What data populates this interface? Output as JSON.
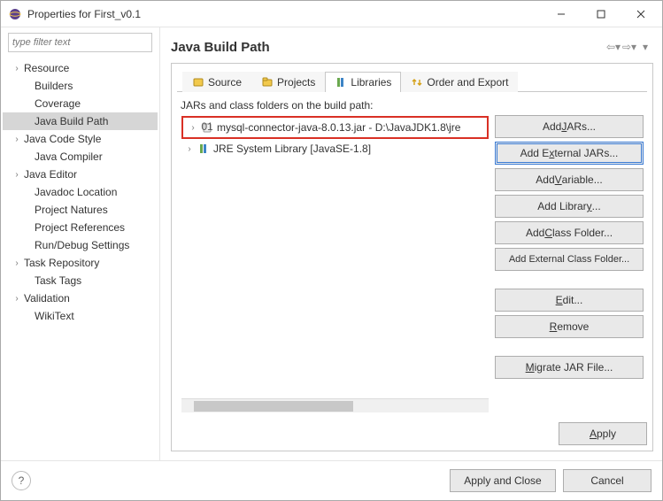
{
  "window": {
    "title": "Properties for First_v0.1"
  },
  "filter_placeholder": "type filter text",
  "tree": {
    "items": [
      {
        "label": "Resource",
        "expandable": true
      },
      {
        "label": "Builders",
        "child": true
      },
      {
        "label": "Coverage",
        "child": true
      },
      {
        "label": "Java Build Path",
        "child": true,
        "selected": true
      },
      {
        "label": "Java Code Style",
        "expandable": true
      },
      {
        "label": "Java Compiler",
        "child": true
      },
      {
        "label": "Java Editor",
        "expandable": true
      },
      {
        "label": "Javadoc Location",
        "child": true
      },
      {
        "label": "Project Natures",
        "child": true
      },
      {
        "label": "Project References",
        "child": true
      },
      {
        "label": "Run/Debug Settings",
        "child": true
      },
      {
        "label": "Task Repository",
        "expandable": true
      },
      {
        "label": "Task Tags",
        "child": true
      },
      {
        "label": "Validation",
        "expandable": true
      },
      {
        "label": "WikiText",
        "child": true
      }
    ]
  },
  "page": {
    "title": "Java Build Path",
    "tabs": [
      "Source",
      "Projects",
      "Libraries",
      "Order and Export"
    ],
    "active_tab": "Libraries",
    "list_label": "JARs and class folders on the build path:",
    "entries": [
      "mysql-connector-java-8.0.13.jar - D:\\JavaJDK1.8\\jre",
      "JRE System Library [JavaSE-1.8]"
    ],
    "buttons": {
      "add_jars": "Add JARs...",
      "add_external_jars": "Add External JARs...",
      "add_variable": "Add Variable...",
      "add_library": "Add Library...",
      "add_class_folder": "Add Class Folder...",
      "add_external_class_folder": "Add External Class Folder...",
      "edit": "Edit...",
      "remove": "Remove",
      "migrate": "Migrate JAR File..."
    },
    "apply": "Apply"
  },
  "footer": {
    "apply_close": "Apply and Close",
    "cancel": "Cancel"
  }
}
